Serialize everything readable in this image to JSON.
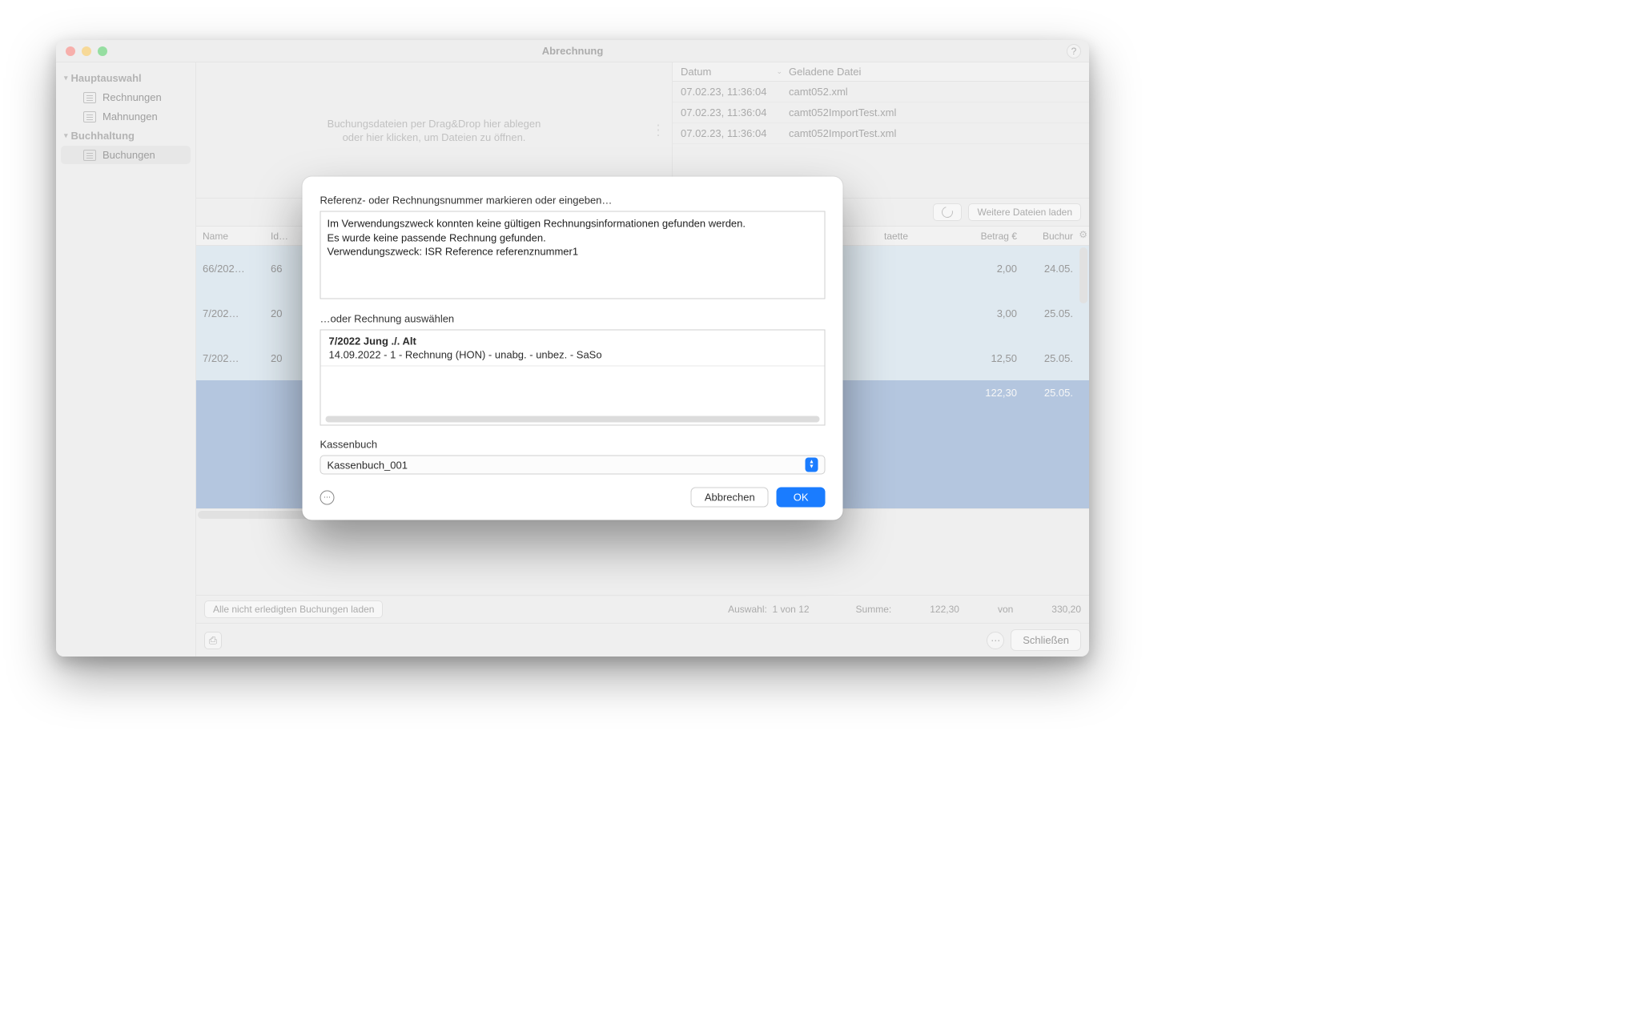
{
  "window": {
    "title": "Abrechnung",
    "help_tooltip": "?"
  },
  "sidebar": {
    "sections": [
      {
        "header": "Hauptauswahl",
        "items": [
          {
            "label": "Rechnungen"
          },
          {
            "label": "Mahnungen"
          }
        ]
      },
      {
        "header": "Buchhaltung",
        "items": [
          {
            "label": "Buchungen",
            "selected": true
          }
        ]
      }
    ]
  },
  "dropzone": {
    "line1": "Buchungsdateien per Drag&Drop hier ablegen",
    "line2": "oder hier klicken, um Dateien zu öffnen."
  },
  "filelist": {
    "columns": {
      "datum": "Datum",
      "datei": "Geladene Datei"
    },
    "rows": [
      {
        "datum": "07.02.23, 11:36:04",
        "datei": "camt052.xml"
      },
      {
        "datum": "07.02.23, 11:36:04",
        "datei": "camt052ImportTest.xml"
      },
      {
        "datum": "07.02.23, 11:36:04",
        "datei": "camt052ImportTest.xml"
      }
    ]
  },
  "toolbar": {
    "more_files_label": "Weitere Dateien laden"
  },
  "table": {
    "columns": {
      "name": "Name",
      "id": "Id…",
      "taette": "taette",
      "betrag": "Betrag €",
      "buchur": "Buchur"
    },
    "rows": [
      {
        "name": "66/202…",
        "id": "66",
        "betrag": "2,00",
        "buch": "24.05.",
        "class": "lightblue"
      },
      {
        "name": "7/202…",
        "id": "20",
        "betrag": "3,00",
        "buch": "25.05.",
        "class": "lightblue"
      },
      {
        "name": "7/202…",
        "id": "20",
        "betrag": "12,50",
        "buch": "25.05.",
        "class": "lightblue"
      },
      {
        "name": "",
        "id": "",
        "betrag": "122,30",
        "buch": "25.05.",
        "class": "sel big"
      }
    ]
  },
  "below": {
    "load_all_label": "Alle nicht erledigten Buchungen laden",
    "auswahl_label": "Auswahl:",
    "auswahl_value": "1 von 12",
    "summe_label": "Summe:",
    "summe_value": "122,30",
    "von_label": "von",
    "total_value": "330,20"
  },
  "footer": {
    "close_label": "Schließen"
  },
  "modal": {
    "ref_label": "Referenz- oder Rechnungsnummer markieren oder eingeben…",
    "ref_text": "Im Verwendungszweck konnten keine gültigen Rechnungsinformationen gefunden werden.\nEs wurde keine passende Rechnung gefunden.\nVerwendungszweck: ISR Reference referenznummer1",
    "pick_label": "…oder Rechnung auswählen",
    "list": {
      "title": "7/2022 Jung ./. Alt",
      "subtitle": "14.09.2022 - 1 - Rechnung (HON) - unabg. - unbez. - SaSo"
    },
    "kassenbuch_label": "Kassenbuch",
    "kassenbuch_value": "Kassenbuch_001",
    "cancel_label": "Abbrechen",
    "ok_label": "OK"
  }
}
